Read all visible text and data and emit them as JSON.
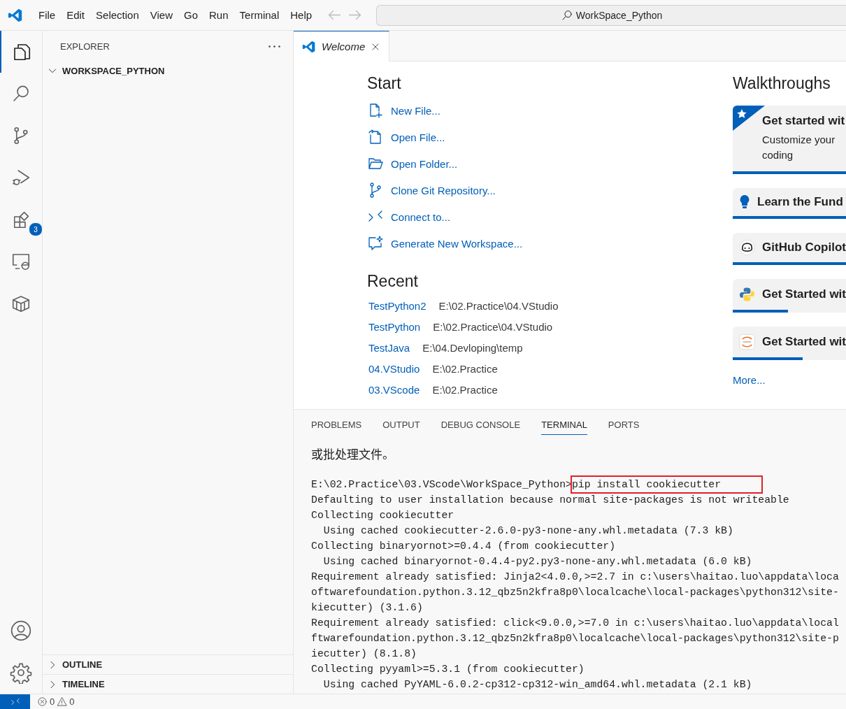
{
  "title_bar": {
    "menu": [
      "File",
      "Edit",
      "Selection",
      "View",
      "Go",
      "Run",
      "Terminal",
      "Help"
    ],
    "back_disabled": true,
    "forward_disabled": true,
    "search": "WorkSpace_Python"
  },
  "activity_bar": {
    "items": [
      {
        "kind": "explorer",
        "selected": true
      },
      {
        "kind": "search",
        "selected": false
      },
      {
        "kind": "source-control",
        "selected": false
      },
      {
        "kind": "run-debug",
        "selected": false
      },
      {
        "kind": "extensions",
        "selected": false,
        "badge": "3"
      },
      {
        "kind": "remote",
        "selected": false
      },
      {
        "kind": "containers",
        "selected": false
      }
    ],
    "bottom": [
      {
        "kind": "account"
      },
      {
        "kind": "settings"
      }
    ]
  },
  "sidebar": {
    "title": "EXPLORER",
    "folder": {
      "label": "WORKSPACE_PYTHON",
      "expanded": true
    },
    "sections": [
      {
        "label": "OUTLINE",
        "expanded": false
      },
      {
        "label": "TIMELINE",
        "expanded": false
      }
    ]
  },
  "editor_tabs": [
    {
      "label": "Welcome",
      "selected": true
    }
  ],
  "welcome": {
    "start_heading": "Start",
    "start_items": [
      {
        "kind": "new-file",
        "label": "New File..."
      },
      {
        "kind": "open-file",
        "label": "Open File..."
      },
      {
        "kind": "open-folder",
        "label": "Open Folder..."
      },
      {
        "kind": "clone",
        "label": "Clone Git Repository..."
      },
      {
        "kind": "connect",
        "label": "Connect to..."
      },
      {
        "kind": "generate",
        "label": "Generate New Workspace..."
      }
    ],
    "recent_heading": "Recent",
    "recent": [
      {
        "name": "TestPython2",
        "path": "E:\\02.Practice\\04.VStudio"
      },
      {
        "name": "TestPython",
        "path": "E:\\02.Practice\\04.VStudio"
      },
      {
        "name": "TestJava",
        "path": "E:\\04.Devloping\\temp"
      },
      {
        "name": "04.VStudio",
        "path": "E:\\02.Practice"
      },
      {
        "name": "03.VScode",
        "path": "E:\\02.Practice"
      }
    ],
    "walkthroughs_heading": "Walkthroughs",
    "walkthroughs": [
      {
        "kind": "featured",
        "title": "Get started wit",
        "description": "Customize your coding",
        "level": 1
      },
      {
        "kind": "bulb",
        "title": "Learn the Fund",
        "level": 1
      },
      {
        "kind": "copilot",
        "title": "GitHub Copilot",
        "level": 1
      },
      {
        "kind": "python",
        "title": "Get Started wit",
        "level": 0.49
      },
      {
        "kind": "jupyter",
        "title": "Get Started wit",
        "level": 0.62
      }
    ],
    "more": "More..."
  },
  "panel": {
    "tabs": [
      {
        "label": "PROBLEMS",
        "selected": false
      },
      {
        "label": "OUTPUT",
        "selected": false
      },
      {
        "label": "DEBUG CONSOLE",
        "selected": false
      },
      {
        "label": "TERMINAL",
        "selected": true
      },
      {
        "label": "PORTS",
        "selected": false
      }
    ],
    "terminal": [
      {
        "kind": "cjk",
        "text": "或批处理文件。"
      },
      {
        "kind": "command",
        "prompt": "E:\\02.Practice\\03.VScode\\WorkSpace_Python>",
        "command": "pip install cookiecutter",
        "highlighted": true
      },
      {
        "kind": "output",
        "text": "Defaulting to user installation because normal site-packages is not writeable"
      },
      {
        "kind": "output",
        "text": "Collecting cookiecutter"
      },
      {
        "kind": "output",
        "text": "  Using cached cookiecutter-2.6.0-py3-none-any.whl.metadata (7.3 kB)"
      },
      {
        "kind": "output",
        "text": "Collecting binaryornot>=0.4.4 (from cookiecutter)"
      },
      {
        "kind": "output",
        "text": "  Using cached binaryornot-0.4.4-py2.py3-none-any.whl.metadata (6.0 kB)"
      },
      {
        "kind": "output",
        "text": "Requirement already satisfied: Jinja2<4.0.0,>=2.7 in c:\\users\\haitao.luo\\appdata\\loca"
      },
      {
        "kind": "output",
        "text": "oftwarefoundation.python.3.12_qbz5n2kfra8p0\\localcache\\local-packages\\python312\\site-"
      },
      {
        "kind": "output",
        "text": "kiecutter) (3.1.6)"
      },
      {
        "kind": "output",
        "text": "Requirement already satisfied: click<9.0.0,>=7.0 in c:\\users\\haitao.luo\\appdata\\local"
      },
      {
        "kind": "output",
        "text": "ftwarefoundation.python.3.12_qbz5n2kfra8p0\\localcache\\local-packages\\python312\\site-p"
      },
      {
        "kind": "output",
        "text": "iecutter) (8.1.8)"
      },
      {
        "kind": "output",
        "text": "Collecting pyyaml>=5.3.1 (from cookiecutter)"
      },
      {
        "kind": "output",
        "text": "  Using cached PyYAML-6.0.2-cp312-cp312-win_amd64.whl.metadata (2.1 kB)"
      }
    ]
  },
  "status_bar": {
    "errors": "0",
    "warnings": "0"
  }
}
